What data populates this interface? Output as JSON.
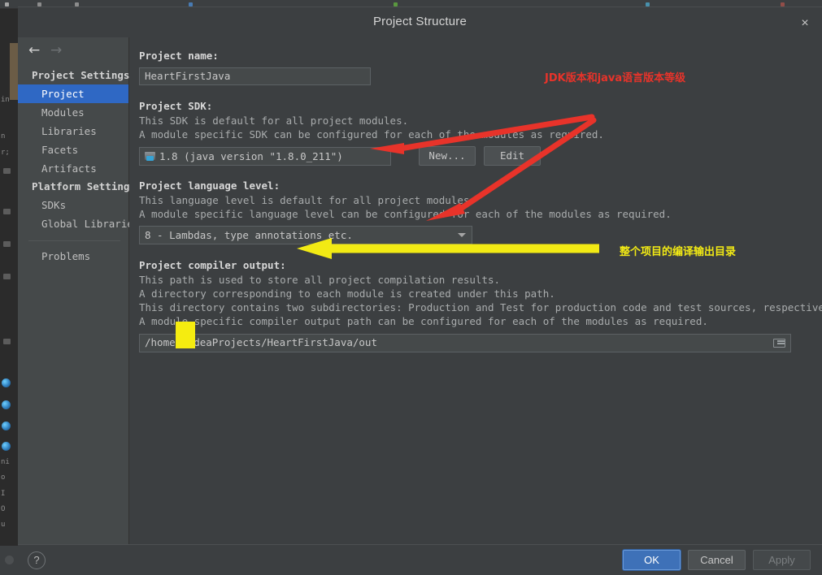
{
  "window": {
    "title": "Project Structure",
    "close_label": "×"
  },
  "nav": {
    "back_icon": "←",
    "forward_icon": "→",
    "groups": [
      {
        "label": "Project Settings",
        "items": [
          {
            "label": "Project",
            "selected": true
          },
          {
            "label": "Modules",
            "selected": false
          },
          {
            "label": "Libraries",
            "selected": false
          },
          {
            "label": "Facets",
            "selected": false
          },
          {
            "label": "Artifacts",
            "selected": false
          }
        ]
      },
      {
        "label": "Platform Settings",
        "items": [
          {
            "label": "SDKs",
            "selected": false
          },
          {
            "label": "Global Libraries",
            "selected": false
          }
        ]
      }
    ],
    "extra_item": "Problems"
  },
  "main": {
    "project_name": {
      "label": "Project name:",
      "value": "HeartFirstJava"
    },
    "project_sdk": {
      "label": "Project SDK:",
      "desc_line1": "This SDK is default for all project modules.",
      "desc_line2": "A module specific SDK can be configured for each of the modules as required.",
      "value": "1.8 (java version \"1.8.0_211\")",
      "new_button": "New...",
      "edit_button": "Edit"
    },
    "language_level": {
      "label": "Project language level:",
      "desc_line1": "This language level is default for all project modules.",
      "desc_line2": "A module specific language level can be configured for each of the modules as required.",
      "value": "8 - Lambdas, type annotations etc."
    },
    "compiler_output": {
      "label": "Project compiler output:",
      "desc_line1": "This path is used to store all project compilation results.",
      "desc_line2": "A directory corresponding to each module is created under this path.",
      "desc_line3": "This directory contains two subdirectories: Production and Test for production code and test sources, respectively.",
      "desc_line4": "A module specific compiler output path can be configured for each of the modules as required.",
      "value": "/home      /IdeaProjects/HeartFirstJava/out"
    }
  },
  "annotations": {
    "sdk_note": "JDK版本和java语言版本等级",
    "sdk_note_color": "#e8332a",
    "output_note": "整个项目的编译输出目录",
    "output_note_color": "#f2ea14"
  },
  "footer": {
    "help_label": "?",
    "ok_label": "OK",
    "cancel_label": "Cancel",
    "apply_label": "Apply"
  }
}
